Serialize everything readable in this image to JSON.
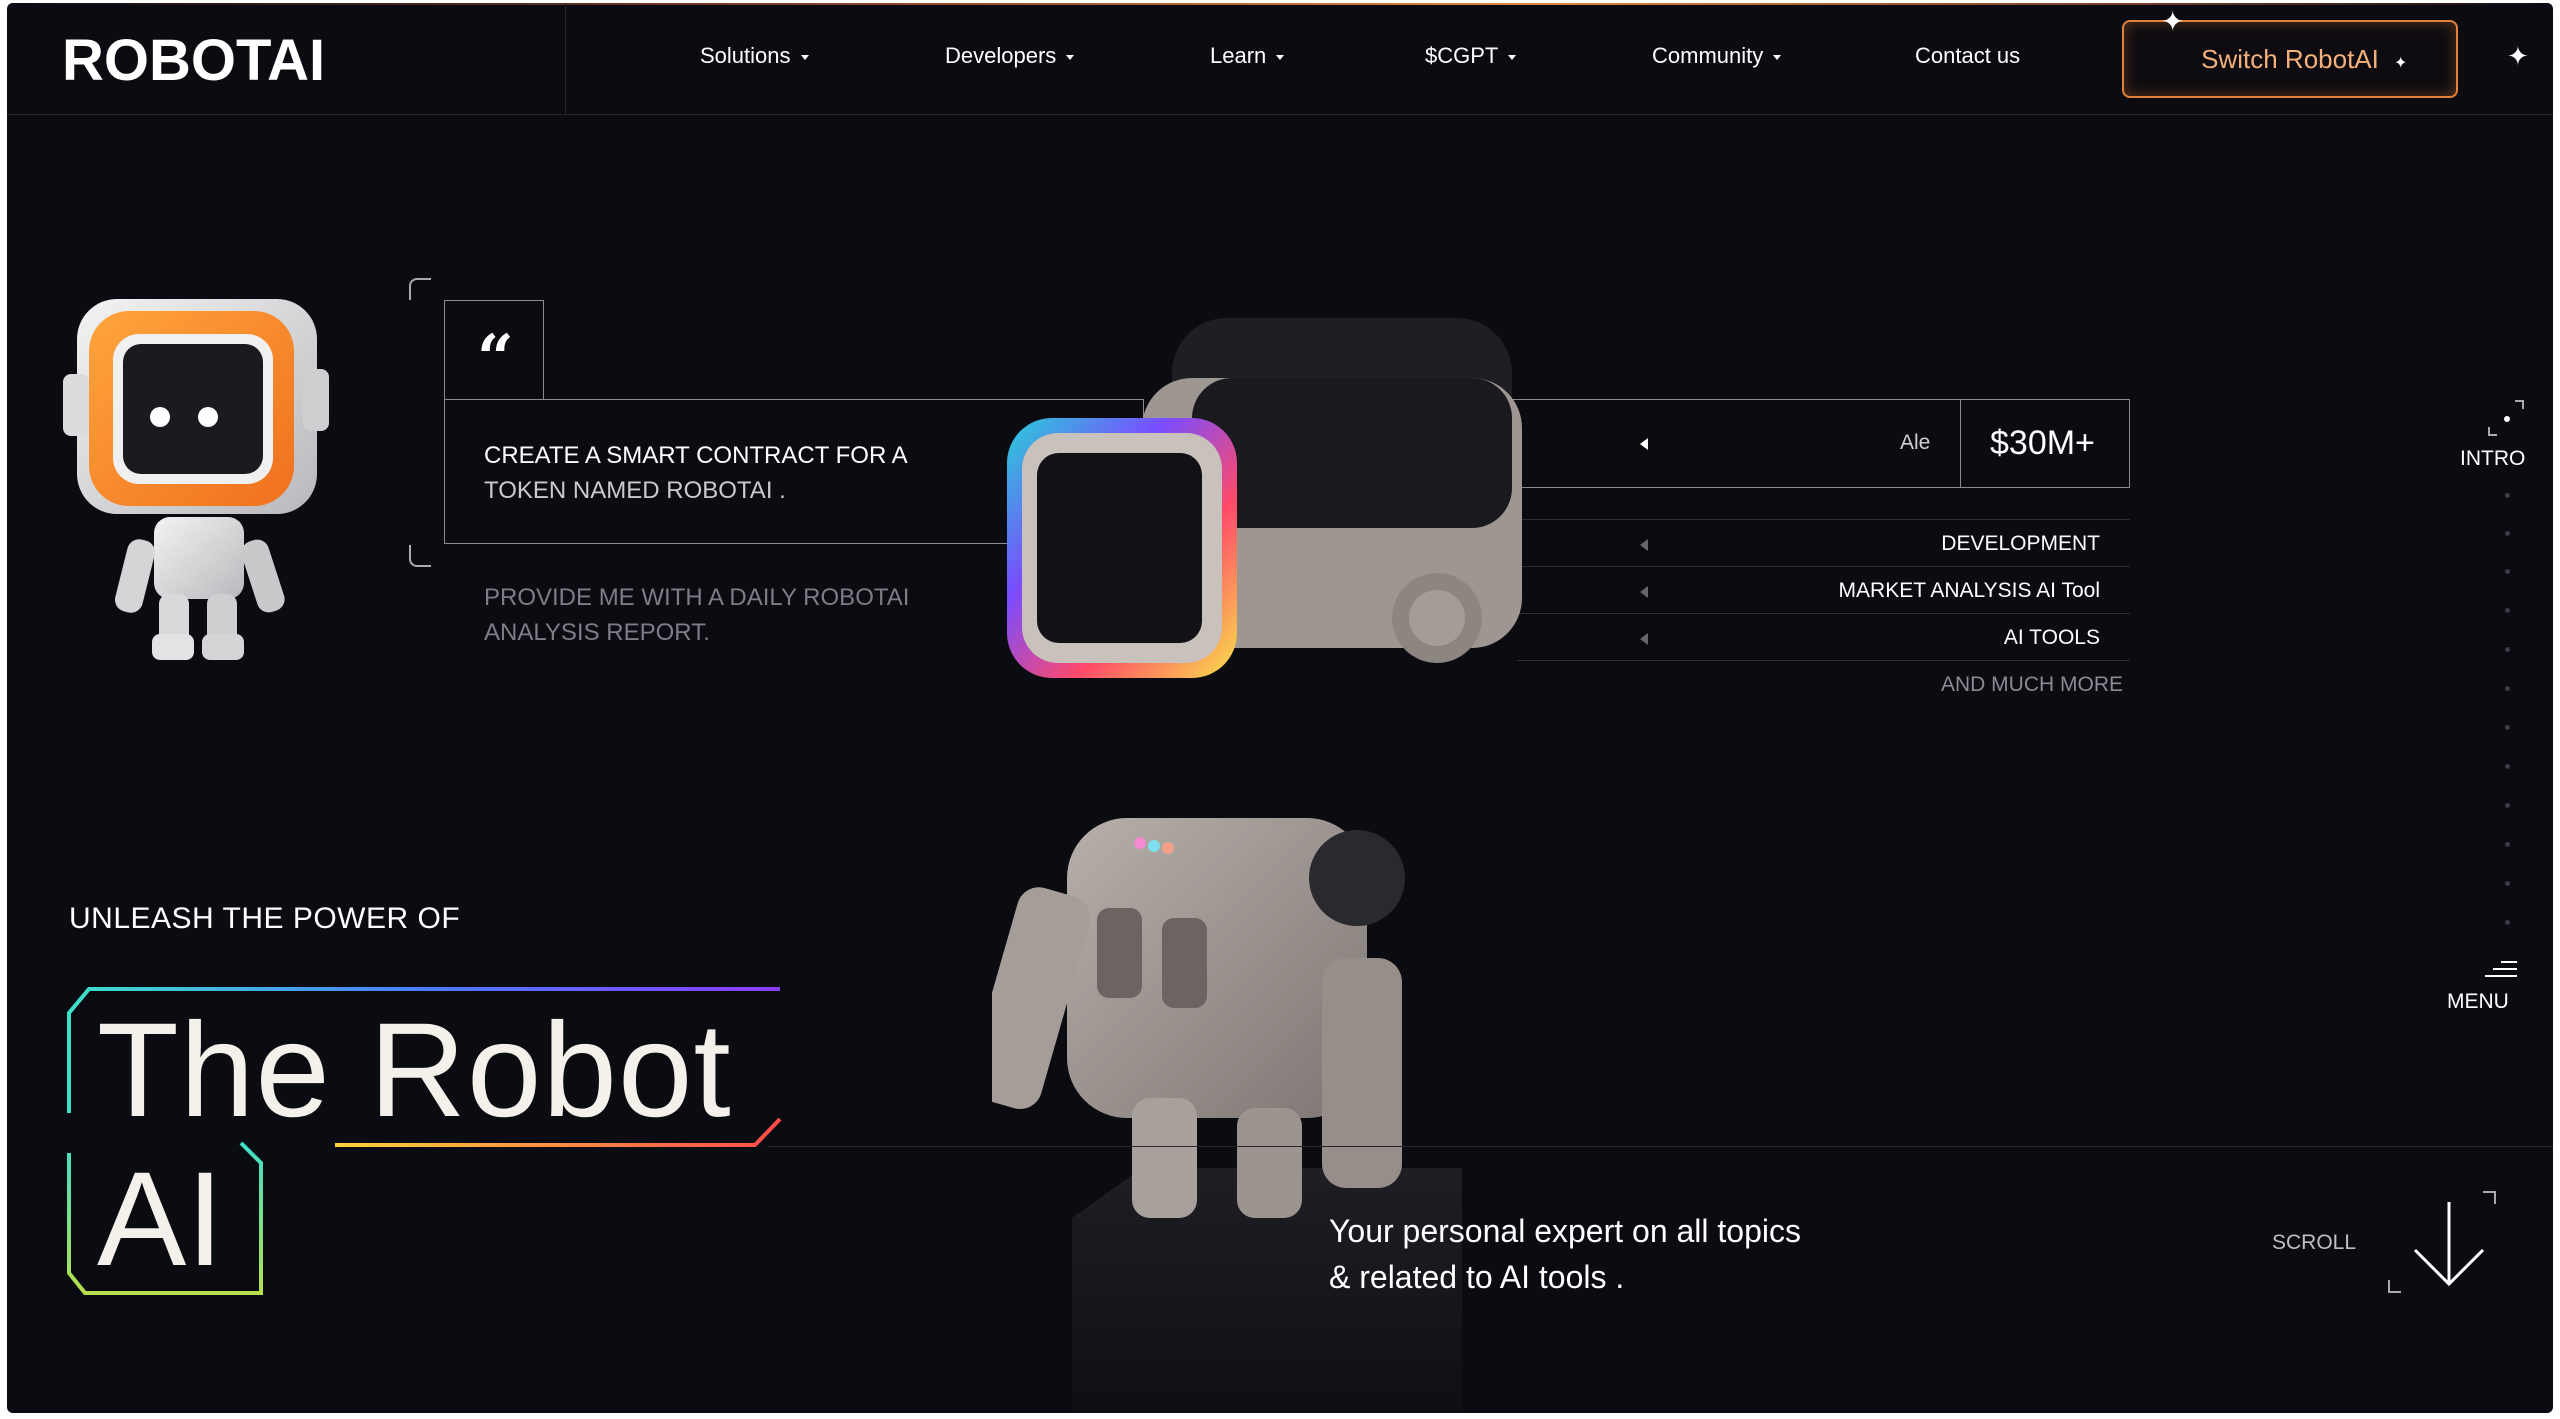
{
  "brand": {
    "logo": "ROBOTAI"
  },
  "nav": {
    "items": [
      {
        "label": "Solutions",
        "has_caret": true
      },
      {
        "label": "Developers",
        "has_caret": true
      },
      {
        "label": "Learn",
        "has_caret": true
      },
      {
        "label": "$CGPT",
        "has_caret": true
      },
      {
        "label": "Community",
        "has_caret": true
      },
      {
        "label": "Contact us",
        "has_caret": false
      }
    ],
    "cta": "Switch RobotAI"
  },
  "prompt_card": {
    "quote_icon": "quote-icon",
    "line1": "CREATE A SMART CONTRACT FOR A",
    "line2": "TOKEN NAMED ROBOTAI .",
    "secondary_line1": "PROVIDE ME WITH A DAILY ROBOTAI",
    "secondary_line2": "ANALYSIS REPORT."
  },
  "stats_card": {
    "label": "Ale",
    "value": "$30M+",
    "list": [
      "DEVELOPMENT",
      "MARKET ANALYSIS AI Tool",
      "AI TOOLS"
    ],
    "more": "AND MUCH MORE"
  },
  "hero": {
    "eyebrow": "UNLEASH THE POWER OF",
    "title_line1": "The Robot",
    "title_line2": "AI"
  },
  "tagline": {
    "line1": "Your personal expert on all topics",
    "line2": "& related to AI tools ."
  },
  "side_rail": {
    "top": "INTRO",
    "bottom": "MENU"
  },
  "scroll": {
    "label": "SCROLL"
  },
  "colors": {
    "background": "#0b0b12",
    "accent": "#e2813a",
    "cta_text": "#f4b07a"
  }
}
